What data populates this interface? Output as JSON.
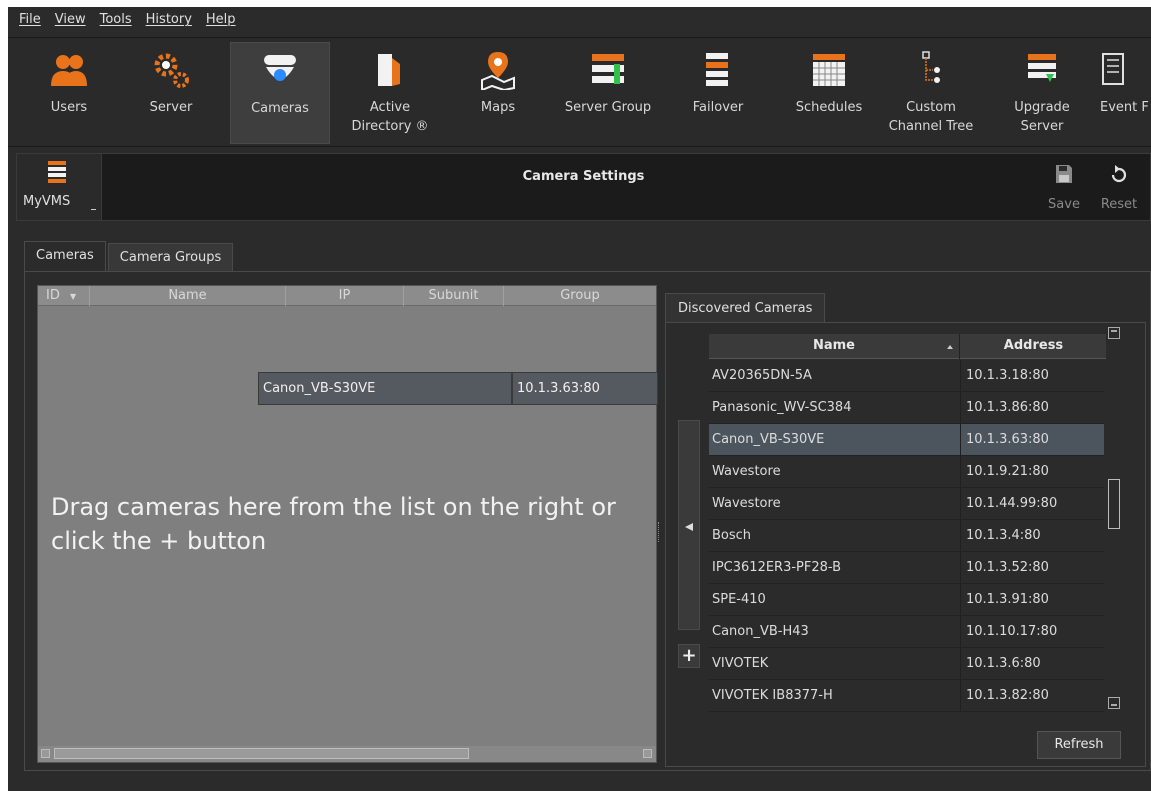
{
  "menubar": {
    "items": [
      "File",
      "View",
      "Tools",
      "History",
      "Help"
    ]
  },
  "toolbar": {
    "items": [
      {
        "label": "Users",
        "icon": "users-icon"
      },
      {
        "label": "Server",
        "icon": "server-gears-icon"
      },
      {
        "label": "Cameras",
        "icon": "camera-dome-icon",
        "active": true
      },
      {
        "label": "Active\nDirectory ®",
        "icon": "active-directory-icon"
      },
      {
        "label": "Maps",
        "icon": "map-pin-icon"
      },
      {
        "label": "Server Group",
        "icon": "server-group-icon"
      },
      {
        "label": "Failover",
        "icon": "failover-icon"
      },
      {
        "label": "Schedules",
        "icon": "schedule-calendar-icon"
      },
      {
        "label": "Custom\nChannel Tree",
        "icon": "channel-tree-icon"
      },
      {
        "label": "Upgrade\nServer",
        "icon": "upgrade-server-icon"
      },
      {
        "label": "Event F",
        "icon": "event-book-icon"
      }
    ]
  },
  "settings": {
    "server_label": "MyVMS",
    "title": "Camera Settings",
    "save_label": "Save",
    "reset_label": "Reset"
  },
  "tabs": {
    "cameras": "Cameras",
    "camera_groups": "Camera Groups"
  },
  "camera_table": {
    "columns": [
      "ID",
      "Name",
      "IP",
      "Subunit",
      "Group"
    ],
    "drag_hint": "Drag cameras here from the list on the right or click the + button",
    "drag_row": {
      "name": "Canon_VB-S30VE",
      "ip": "10.1.3.63:80"
    }
  },
  "discovered": {
    "tab_label": "Discovered Cameras",
    "columns": [
      "Name",
      "Address"
    ],
    "rows": [
      {
        "name": "AV20365DN-5A",
        "address": "10.1.3.18:80"
      },
      {
        "name": "Panasonic_WV-SC384",
        "address": "10.1.3.86:80"
      },
      {
        "name": "Canon_VB-S30VE",
        "address": "10.1.3.63:80",
        "selected": true
      },
      {
        "name": "Wavestore",
        "address": "10.1.9.21:80"
      },
      {
        "name": "Wavestore",
        "address": "10.1.44.99:80"
      },
      {
        "name": "Bosch",
        "address": "10.1.3.4:80"
      },
      {
        "name": "IPC3612ER3-PF28-B",
        "address": "10.1.3.52:80"
      },
      {
        "name": "SPE-410",
        "address": "10.1.3.91:80"
      },
      {
        "name": "Canon_VB-H43",
        "address": "10.1.10.17:80"
      },
      {
        "name": "VIVOTEK",
        "address": "10.1.3.6:80"
      },
      {
        "name": "VIVOTEK IB8377-H",
        "address": "10.1.3.82:80"
      }
    ],
    "add_label": "+",
    "refresh_label": "Refresh"
  },
  "colors": {
    "accent_orange": "#e8731a",
    "selection": "#4c545e",
    "background": "#2b2b2b"
  }
}
